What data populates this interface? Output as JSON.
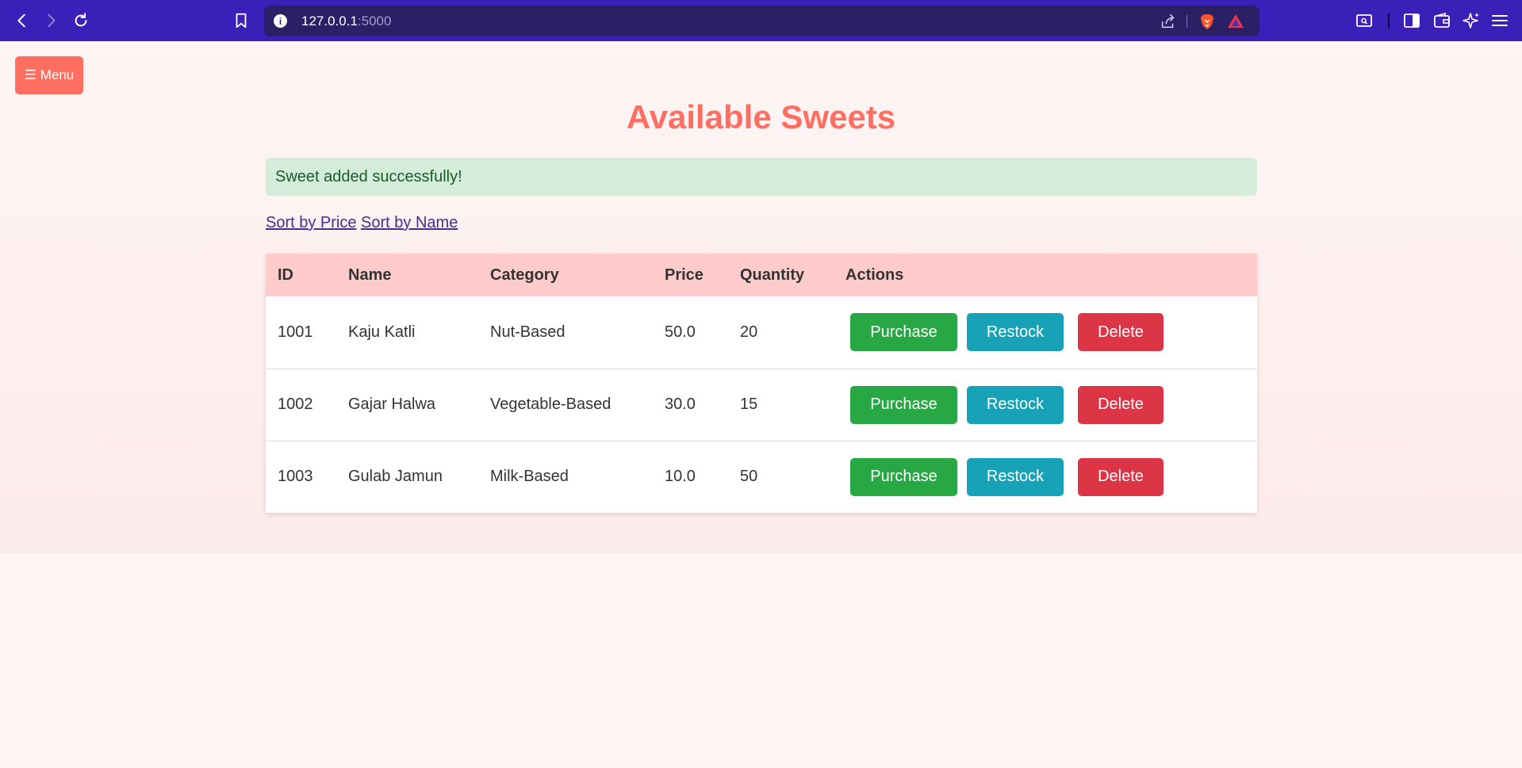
{
  "browser": {
    "url_host": "127.0.0.1",
    "url_port": ":5000"
  },
  "page": {
    "menu_label": "☰ Menu",
    "title": "Available Sweets",
    "alert": "Sweet added successfully!",
    "sort_price": "Sort by Price",
    "sort_name": "Sort by Name"
  },
  "table": {
    "headers": [
      "ID",
      "Name",
      "Category",
      "Price",
      "Quantity",
      "Actions"
    ],
    "rows": [
      {
        "id": "1001",
        "name": "Kaju Katli",
        "category": "Nut-Based",
        "price": "50.0",
        "quantity": "20"
      },
      {
        "id": "1002",
        "name": "Gajar Halwa",
        "category": "Vegetable-Based",
        "price": "30.0",
        "quantity": "15"
      },
      {
        "id": "1003",
        "name": "Gulab Jamun",
        "category": "Milk-Based",
        "price": "10.0",
        "quantity": "50"
      }
    ],
    "actions": {
      "purchase": "Purchase",
      "restock": "Restock",
      "delete": "Delete"
    }
  },
  "colors": {
    "accent": "#ff6f61",
    "purchase": "#28a745",
    "restock": "#17a2b8",
    "delete": "#dc3545",
    "header_row": "#ffcccb",
    "alert_bg": "#d4ecda"
  }
}
